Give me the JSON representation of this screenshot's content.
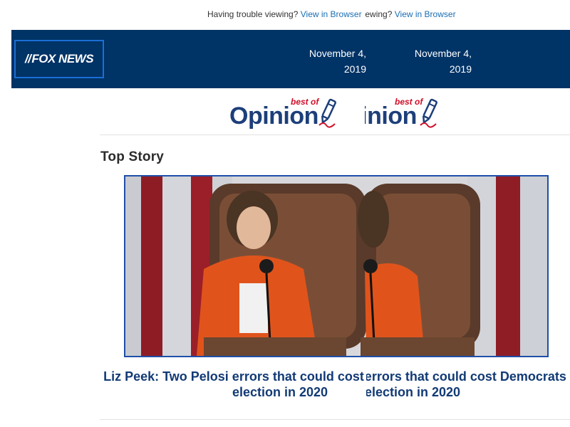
{
  "trouble_bar": {
    "text": "Having trouble viewing?",
    "link": "View in Browser"
  },
  "header": {
    "logo_text": "FOX NEWS",
    "date": "November 4, 2019",
    "date_line1": "November 4,",
    "date_line2": "2019"
  },
  "opinion_banner": {
    "best_of": "best of",
    "word": "Opinion"
  },
  "section": {
    "title": "Top Story"
  },
  "story": {
    "headline_line1": "Liz Peek: Two Pelosi errors that could cost Democrats the",
    "headline_line2": "election in 2020"
  },
  "colors": {
    "header_bg": "#003366",
    "link": "#1a6fb5",
    "headline": "#123a75",
    "opinion_red": "#d0102a",
    "opinion_blue": "#1d3f7a"
  }
}
